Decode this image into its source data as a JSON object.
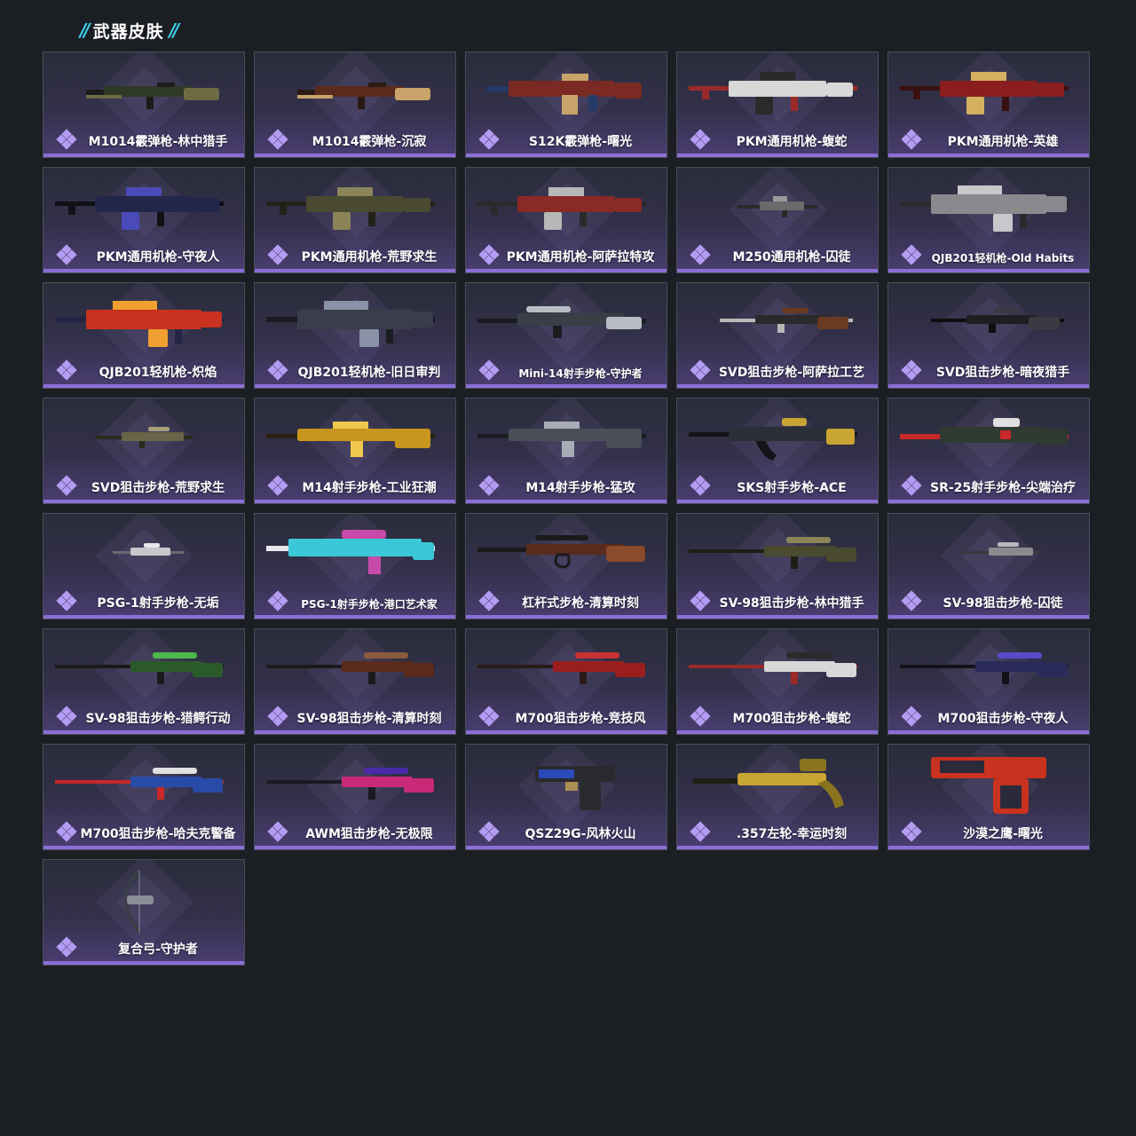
{
  "section": {
    "title": "武器皮肤"
  },
  "colors": {
    "accent_slash": "#3fd3f0",
    "rarity_bar": "#8b6fd6",
    "rarity_icon": "#b49cf2",
    "background": "#1b1f24"
  },
  "skins": [
    {
      "name": "M1014霰弹枪-林中猎手",
      "weapon": "shotgun",
      "colors": [
        "#2e3a26",
        "#6e6a44",
        "#1c1c1c"
      ]
    },
    {
      "name": "M1014霰弹枪-沉寂",
      "weapon": "shotgun",
      "colors": [
        "#5a2a1c",
        "#c8a46a",
        "#2a1a14"
      ]
    },
    {
      "name": "S12K霰弹枪-曙光",
      "weapon": "shotgun-mag",
      "colors": [
        "#7a2a22",
        "#c8a46a",
        "#243a6a"
      ]
    },
    {
      "name": "PKM通用机枪-蝮蛇",
      "weapon": "mg",
      "colors": [
        "#d8d8d8",
        "#2a2a2a",
        "#9a2a2a"
      ]
    },
    {
      "name": "PKM通用机枪-英雄",
      "weapon": "mg",
      "colors": [
        "#8a1e1e",
        "#d4b060",
        "#3a1010"
      ]
    },
    {
      "name": "PKM通用机枪-守夜人",
      "weapon": "mg",
      "colors": [
        "#22264a",
        "#4a4ab8",
        "#101018"
      ]
    },
    {
      "name": "PKM通用机枪-荒野求生",
      "weapon": "mg",
      "colors": [
        "#4a4a32",
        "#8a8458",
        "#222218"
      ]
    },
    {
      "name": "PKM通用机枪-阿萨拉特攻",
      "weapon": "mg",
      "colors": [
        "#8a2a26",
        "#b8b8b8",
        "#2a2a2a"
      ]
    },
    {
      "name": "M250通用机枪-囚徒",
      "weapon": "mg-small",
      "colors": [
        "#6a6a6a",
        "#9a9a9a",
        "#2a2a2a"
      ]
    },
    {
      "name": "QJB201轻机枪-Old Habits",
      "weapon": "lmg",
      "colors": [
        "#8a8a8e",
        "#c8c8cc",
        "#2a2a2e"
      ]
    },
    {
      "name": "QJB201轻机枪-炽焰",
      "weapon": "lmg",
      "colors": [
        "#c8321e",
        "#f0a030",
        "#242444"
      ]
    },
    {
      "name": "QJB201轻机枪-旧日审判",
      "weapon": "lmg",
      "colors": [
        "#3a3e4a",
        "#8a92a8",
        "#1a1c22"
      ]
    },
    {
      "name": "Mini-14射手步枪-守护者",
      "weapon": "dmr",
      "colors": [
        "#3a3e46",
        "#b8bcc4",
        "#1a1c20"
      ]
    },
    {
      "name": "SVD狙击步枪-阿萨拉工艺",
      "weapon": "svd",
      "colors": [
        "#2a2a2a",
        "#6a3a22",
        "#b8b8b8"
      ]
    },
    {
      "name": "SVD狙击步枪-暗夜猎手",
      "weapon": "svd",
      "colors": [
        "#1e1e22",
        "#3a3a42",
        "#0e0e10"
      ]
    },
    {
      "name": "SVD狙击步枪-荒野求生",
      "weapon": "svd-small",
      "colors": [
        "#6a6448",
        "#a8a078",
        "#2a2a1e"
      ]
    },
    {
      "name": "M14射手步枪-工业狂潮",
      "weapon": "m14",
      "colors": [
        "#c8961e",
        "#f0c850",
        "#2a2214"
      ]
    },
    {
      "name": "M14射手步枪-猛攻",
      "weapon": "m14",
      "colors": [
        "#4a4e58",
        "#a8acb8",
        "#1a1c22"
      ]
    },
    {
      "name": "SKS射手步枪-ACE",
      "weapon": "sks",
      "colors": [
        "#2a2e36",
        "#c8a432",
        "#121418"
      ]
    },
    {
      "name": "SR-25射手步枪-尖端治疗",
      "weapon": "sr25",
      "colors": [
        "#2e3a32",
        "#e0e0e0",
        "#c82828"
      ]
    },
    {
      "name": "PSG-1射手步枪-无垢",
      "weapon": "psg-small",
      "colors": [
        "#c8c8cc",
        "#e8e8ec",
        "#6a6a70"
      ]
    },
    {
      "name": "PSG-1射手步枪-港口艺术家",
      "weapon": "psg",
      "colors": [
        "#3ac8d8",
        "#c84aa8",
        "#e8e8f0"
      ]
    },
    {
      "name": "杠杆式步枪-清算时刻",
      "weapon": "lever",
      "colors": [
        "#5a2a1c",
        "#8a4a2c",
        "#1a1a1a"
      ]
    },
    {
      "name": "SV-98狙击步枪-林中猎手",
      "weapon": "sniper",
      "colors": [
        "#4a4a30",
        "#8a8458",
        "#1e1e16"
      ]
    },
    {
      "name": "SV-98狙击步枪-囚徒",
      "weapon": "sniper-small",
      "colors": [
        "#8a8a8e",
        "#b8b8bc",
        "#3a3a3e"
      ]
    },
    {
      "name": "SV-98狙击步枪-猎鳄行动",
      "weapon": "sniper",
      "colors": [
        "#2a5a2a",
        "#4ab84a",
        "#1a1a1a"
      ]
    },
    {
      "name": "SV-98狙击步枪-清算时刻",
      "weapon": "sniper",
      "colors": [
        "#5a2a1c",
        "#8a5a3a",
        "#1a1a1a"
      ]
    },
    {
      "name": "M700狙击步枪-竞技风",
      "weapon": "sniper",
      "colors": [
        "#9a1e1e",
        "#c83232",
        "#2a1a1a"
      ]
    },
    {
      "name": "M700狙击步枪-蝮蛇",
      "weapon": "sniper",
      "colors": [
        "#d8d8d8",
        "#2a2a2a",
        "#9a2a2a"
      ]
    },
    {
      "name": "M700狙击步枪-守夜人",
      "weapon": "sniper",
      "colors": [
        "#2a2a5a",
        "#5a4ac8",
        "#121218"
      ]
    },
    {
      "name": "M700狙击步枪-哈夫克警备",
      "weapon": "sniper",
      "colors": [
        "#2a4aa8",
        "#e0e0e0",
        "#c82828"
      ]
    },
    {
      "name": "AWM狙击步枪-无极限",
      "weapon": "sniper",
      "colors": [
        "#c82a78",
        "#4a2aa8",
        "#1a1a22"
      ]
    },
    {
      "name": "QSZ29G-风林火山",
      "weapon": "pistol",
      "colors": [
        "#2a2a2e",
        "#2a4ab8",
        "#c8a450"
      ]
    },
    {
      "name": ".357左轮-幸运时刻",
      "weapon": "revolver",
      "colors": [
        "#c8a432",
        "#8a7420",
        "#1e1e14"
      ]
    },
    {
      "name": "沙漠之鹰-曙光",
      "weapon": "deagle",
      "colors": [
        "#c8321e",
        "#2a2a3a",
        "#e0e0e0"
      ]
    },
    {
      "name": "复合弓-守护者",
      "weapon": "bow",
      "colors": [
        "#3a3e46",
        "#8a8e98",
        "#1a1c20"
      ]
    }
  ]
}
